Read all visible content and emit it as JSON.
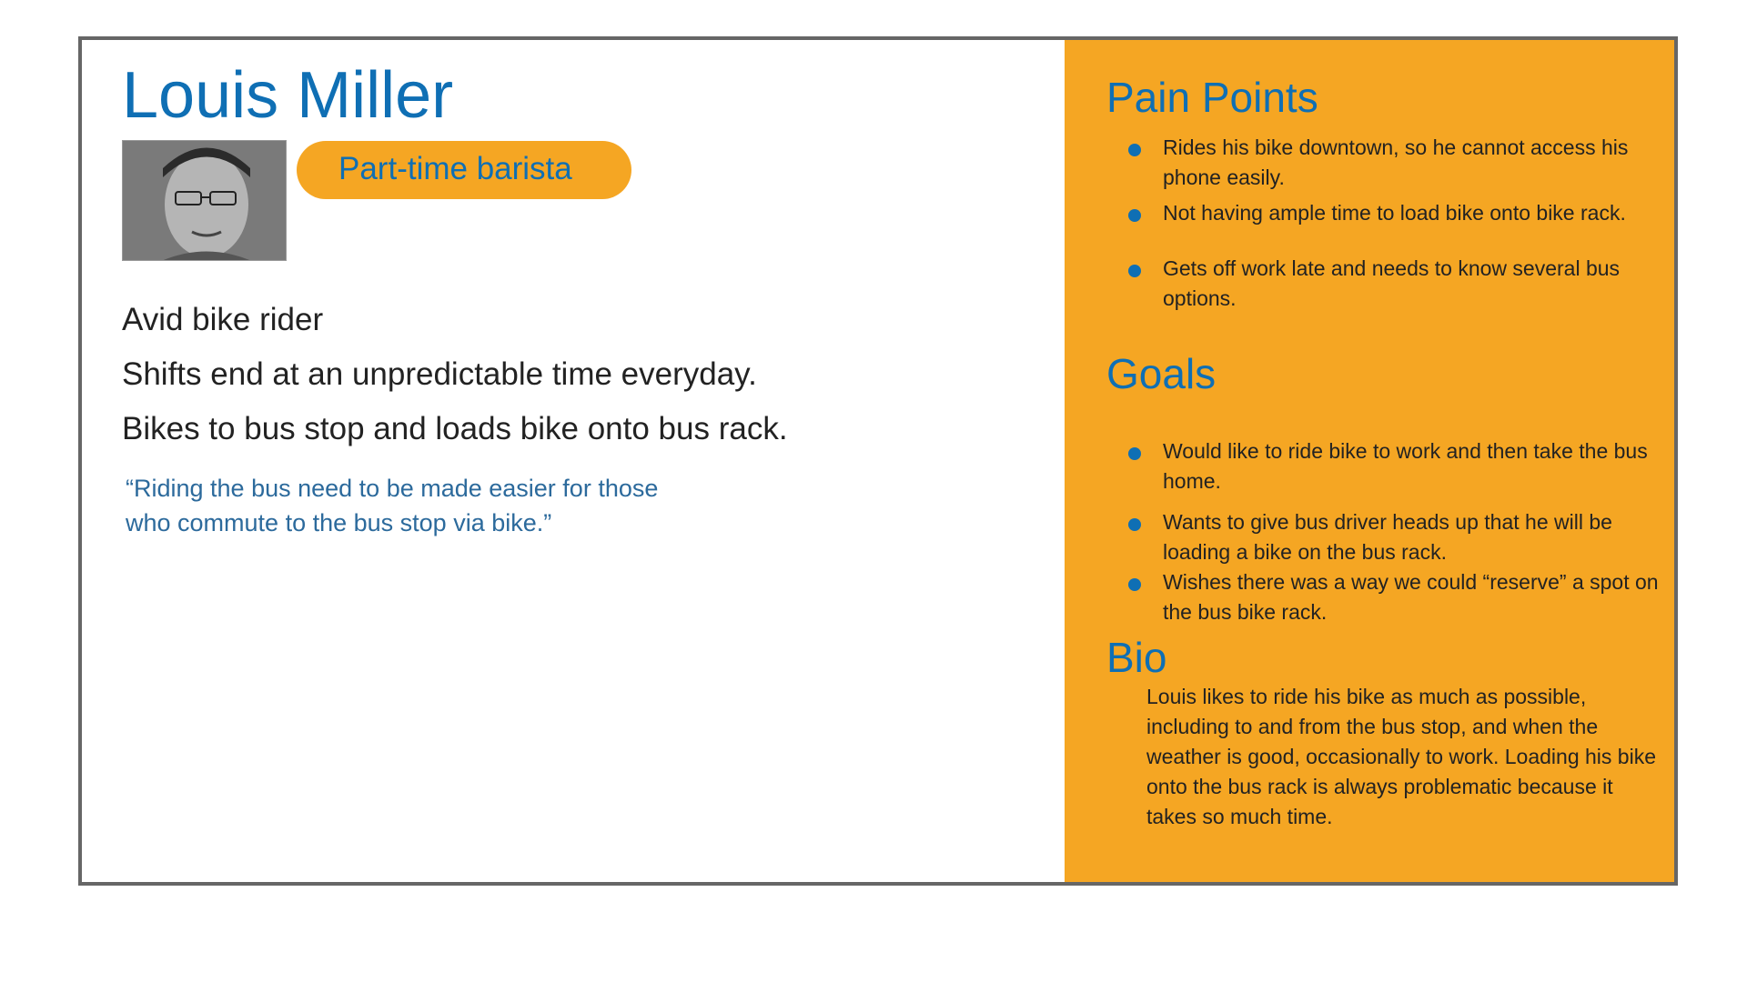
{
  "persona": {
    "name": "Louis Miller",
    "role": "Part-time barista",
    "traits": [
      "Avid bike rider",
      "Shifts end at an unpredictable time everyday.",
      "Bikes to bus stop and loads bike onto bus rack."
    ],
    "quote_line1": "“Riding the bus need to be made easier for those",
    "quote_line2": "who commute to the bus stop via bike.”"
  },
  "pain_points": {
    "title": "Pain Points",
    "items": [
      "Rides his bike downtown, so he cannot access his phone easily.",
      "Not having ample time to load bike onto bike rack.",
      "Gets off work late and needs to know several bus options."
    ]
  },
  "goals": {
    "title": "Goals",
    "items": [
      "Would like to ride bike to work and then take the bus home.",
      "Wants to give bus driver heads up that he will be loading a bike on the bus rack.",
      "Wishes there was a way we could “reserve” a spot on the bus bike rack."
    ]
  },
  "bio": {
    "title": "Bio",
    "text": "Louis likes to ride his bike as much as possible, including to and from the bus stop, and when the weather is good, occasionally to work. Loading his bike onto the bus rack is always problematic because it takes so much time."
  },
  "colors": {
    "accent_orange": "#f5a623",
    "title_blue": "#0f6fb4",
    "quote_blue": "#2c6a9c",
    "border_gray": "#666666"
  }
}
